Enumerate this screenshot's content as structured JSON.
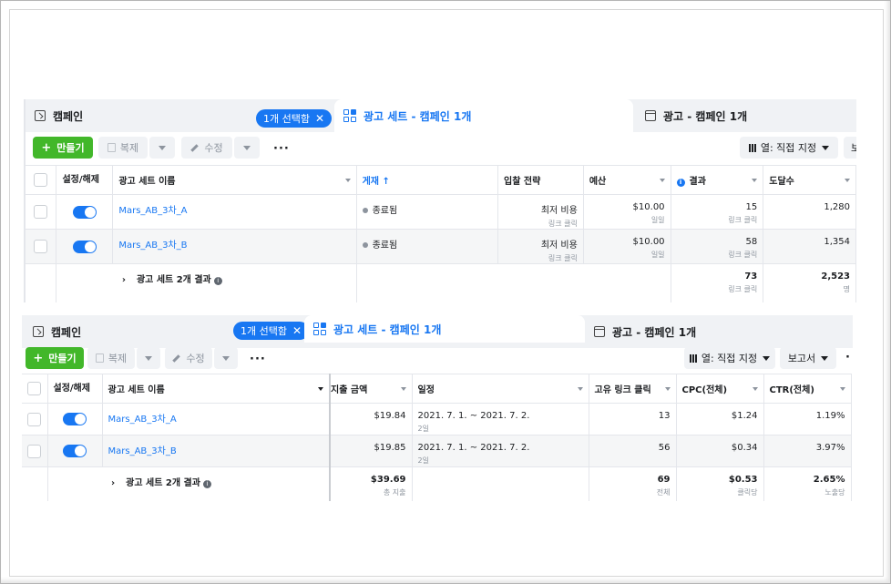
{
  "top": {
    "tabs": {
      "campaign": "캠페인",
      "selected_pill": "1개 선택함",
      "adset": "광고 세트 - 캠페인 1개",
      "ad": "광고 - 캠페인 1개"
    },
    "toolbar": {
      "create": "만들기",
      "duplicate": "복제",
      "edit": "수정",
      "more": "···",
      "columns": "열: 직접 지정",
      "reports": "보"
    },
    "headers": {
      "onoff": "설정/해제",
      "name": "광고 세트 이름",
      "delivery": "게재 ↑",
      "bid": "입찰 전략",
      "budget": "예산",
      "results": "결과",
      "reach": "도달수"
    },
    "rows": [
      {
        "name": "Mars_AB_3차_A",
        "delivery": "종료됨",
        "bid": "최저 비용",
        "bid_sub": "링크 클릭",
        "budget": "$10.00",
        "budget_sub": "일일",
        "results": "15",
        "results_sub": "링크 클릭",
        "reach": "1,280"
      },
      {
        "name": "Mars_AB_3차_B",
        "delivery": "종료됨",
        "bid": "최저 비용",
        "bid_sub": "링크 클릭",
        "budget": "$10.00",
        "budget_sub": "일일",
        "results": "58",
        "results_sub": "링크 클릭",
        "reach": "1,354"
      }
    ],
    "summary": {
      "label": "광고 세트 2개 결과",
      "results": "73",
      "results_sub": "링크 클릭",
      "reach": "2,523",
      "reach_sub": "명"
    }
  },
  "bottom": {
    "tabs": {
      "campaign": "캠페인",
      "selected_pill": "1개 선택함",
      "adset": "광고 세트 - 캠페인 1개",
      "ad": "광고 - 캠페인 1개"
    },
    "toolbar": {
      "create": "만들기",
      "duplicate": "복제",
      "edit": "수정",
      "more": "···",
      "columns": "열: 직접 지정",
      "reports": "보고서",
      "extra": "·"
    },
    "headers": {
      "onoff": "설정/해제",
      "name": "광고 세트 이름",
      "spent": "지출 금액",
      "schedule": "일정",
      "unique_clicks": "고유 링크 클릭",
      "cpc": "CPC(전체)",
      "ctr": "CTR(전체)"
    },
    "rows": [
      {
        "name": "Mars_AB_3차_A",
        "spent": "$19.84",
        "schedule": "2021. 7. 1. ~ 2021. 7. 2.",
        "schedule_sub": "2일",
        "unique_clicks": "13",
        "cpc": "$1.24",
        "ctr": "1.19%"
      },
      {
        "name": "Mars_AB_3차_B",
        "spent": "$19.85",
        "schedule": "2021. 7. 1. ~ 2021. 7. 2.",
        "schedule_sub": "2일",
        "unique_clicks": "56",
        "cpc": "$0.34",
        "ctr": "3.97%"
      }
    ],
    "summary": {
      "label": "광고 세트 2개 결과",
      "spent": "$39.69",
      "spent_sub": "총 지출",
      "unique_clicks": "69",
      "unique_clicks_sub": "전체",
      "cpc": "$0.53",
      "cpc_sub": "클릭당",
      "ctr": "2.65%",
      "ctr_sub": "노출당"
    }
  },
  "colors": {
    "accent": "#1877f2",
    "create_green": "#42b72a",
    "tab_bg": "#f0f2f5"
  },
  "icons": [
    "folder-icon",
    "adset-grid-icon",
    "ad-page-icon",
    "close-icon",
    "plus-icon",
    "duplicate-icon",
    "pencil-icon",
    "columns-icon",
    "caret-down-icon",
    "info-icon",
    "chevron-right-icon",
    "toggle-switch",
    "checkbox"
  ]
}
